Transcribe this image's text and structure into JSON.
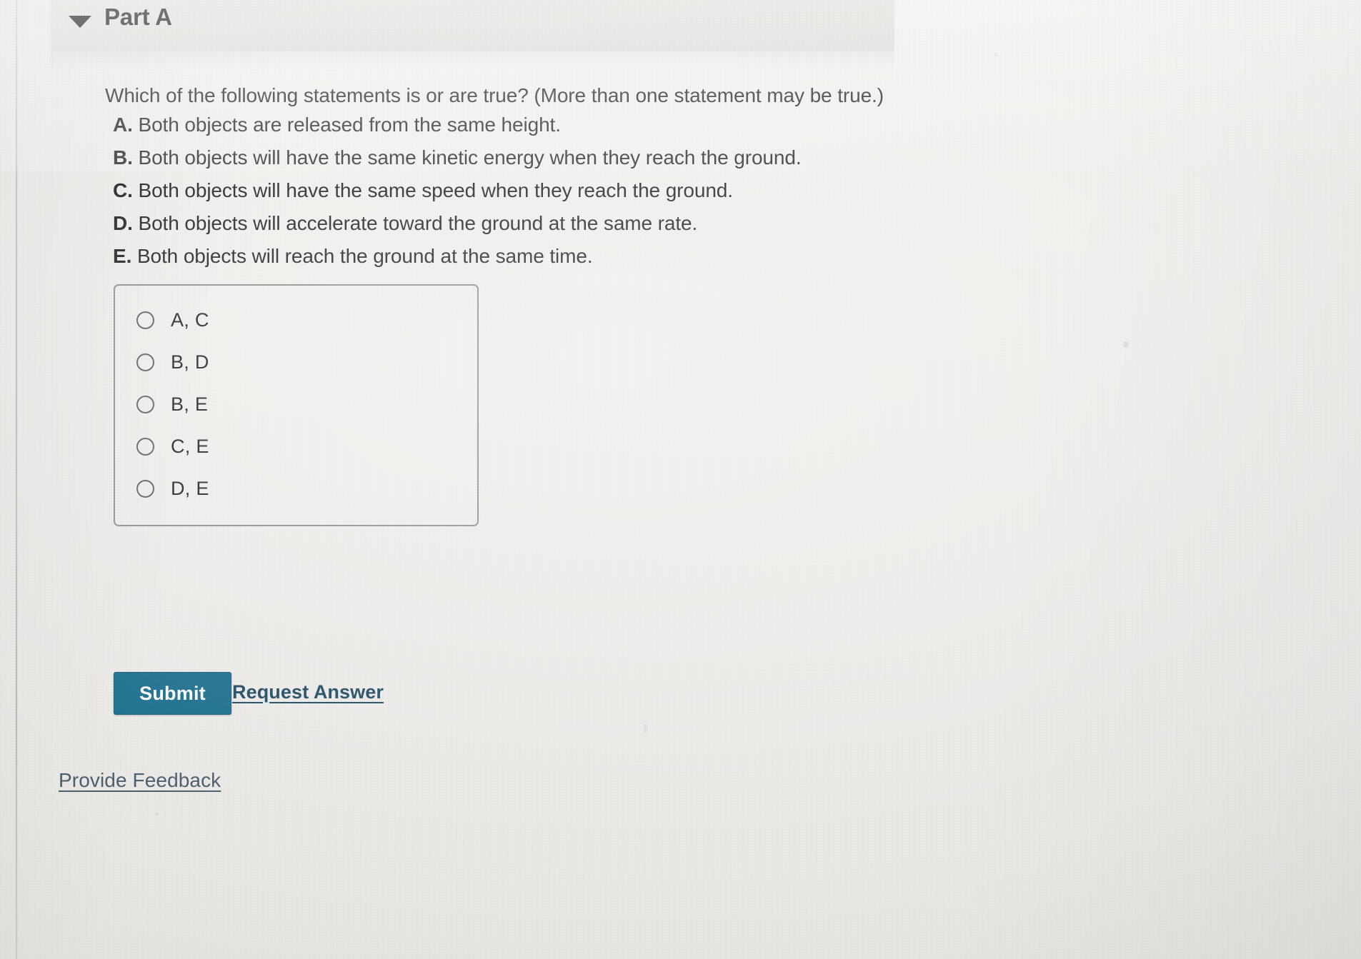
{
  "header": {
    "collapse_icon": "caret-down-icon",
    "title": "Part A"
  },
  "question": {
    "prompt": "Which of the following statements is or are true? (More than one statement may be true.)",
    "statements": [
      {
        "letter": "A.",
        "text": " Both objects are released from the same height."
      },
      {
        "letter": "B.",
        "text": " Both objects will have the same kinetic energy when they reach the ground."
      },
      {
        "letter": "C.",
        "text": " Both objects will have the same speed when they reach the ground."
      },
      {
        "letter": "D.",
        "text": " Both objects will accelerate toward the ground at the same rate."
      },
      {
        "letter": "E.",
        "text": " Both objects will reach the ground at the same time."
      }
    ]
  },
  "answers": {
    "selected": null,
    "options": [
      {
        "label": "A, C",
        "value": "A,C",
        "selected": false
      },
      {
        "label": "B, D",
        "value": "B,D",
        "selected": false
      },
      {
        "label": "B, E",
        "value": "B,E",
        "selected": false
      },
      {
        "label": "C, E",
        "value": "C,E",
        "selected": false
      },
      {
        "label": "D, E",
        "value": "D,E",
        "selected": false
      }
    ]
  },
  "actions": {
    "submit_label": "Submit",
    "request_answer_label": "Request Answer",
    "provide_feedback_label": "Provide Feedback"
  },
  "colors": {
    "submit_background": "#1b6e8f",
    "submit_text": "#ffffff",
    "link": "#1d4a63",
    "feedback_link": "#4b5f6e",
    "header_band": "#e1e0dc",
    "page_background": "#eeedea",
    "choice_box_border": "#8b8d8c"
  }
}
